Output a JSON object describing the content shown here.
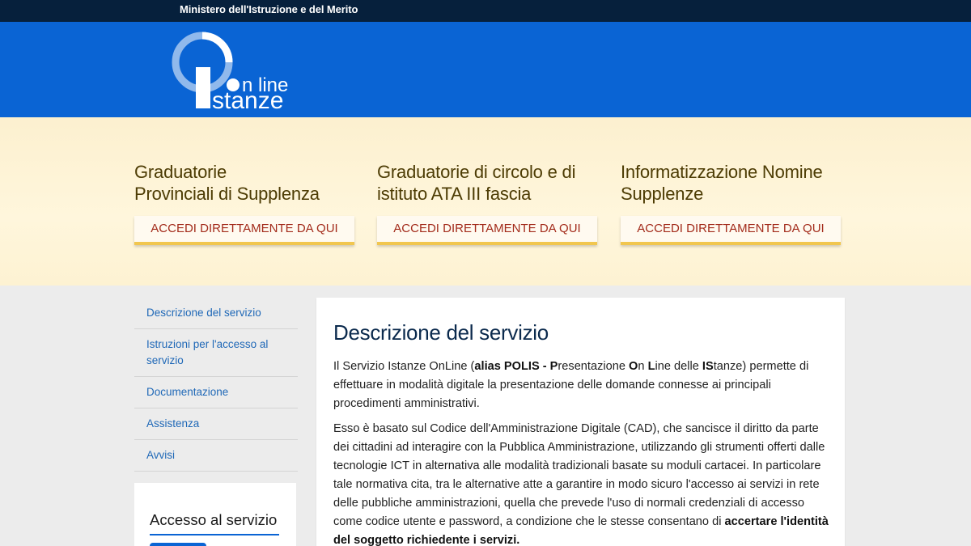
{
  "topbar": {
    "ministry": "Ministero dell'Istruzione e del Merito"
  },
  "logo": {
    "line1": "n line",
    "line2": "stanze"
  },
  "hero": {
    "cards": [
      {
        "title_line1": "Graduatorie",
        "title_line2": "Provinciali di Supplenza",
        "button": "ACCEDI DIRETTAMENTE DA QUI"
      },
      {
        "title_line1": "Graduatorie di circolo e di",
        "title_line2": "istituto ATA III fascia",
        "button": "ACCEDI DIRETTAMENTE DA QUI"
      },
      {
        "title_line1": "Informatizzazione Nomine",
        "title_line2": "Supplenze",
        "button": "ACCEDI DIRETTAMENTE DA QUI"
      }
    ]
  },
  "sidebar": {
    "items": [
      {
        "label": "Descrizione del servizio"
      },
      {
        "label": "Istruzioni per l'accesso al servizio"
      },
      {
        "label": "Documentazione"
      },
      {
        "label": "Assistenza"
      },
      {
        "label": "Avvisi"
      }
    ],
    "access_title": "Accesso al servizio"
  },
  "content": {
    "title": "Descrizione del servizio",
    "p1": {
      "a": "Il Servizio Istanze OnLine (",
      "b1": "alias POLIS - P",
      "c1": "resentazione ",
      "b2": "O",
      "c2": "n ",
      "b3": "L",
      "c3": "ine delle ",
      "b4": "IS",
      "d": "tanze) permette di effettuare in modalità digitale la presentazione delle domande connesse ai principali procedimenti amministrativi."
    },
    "p2": {
      "a": "Esso è basato sul Codice dell'Amministrazione Digitale (CAD), che sancisce il diritto da parte dei cittadini ad interagire con la Pubblica Amministrazione, utilizzando gli strumenti offerti dalle tecnologie ICT in alternativa alle modalità tradizionali basate su moduli cartacei. In particolare tale normativa cita, tra le alternative atte a garantire in modo sicuro l'accesso ai servizi in rete delle pubbliche amministrazioni, quella che prevede l'uso di normali credenziali di accesso come codice utente e password, a condizione che le stesse consentano di ",
      "b": "accertare l'identità del soggetto richiedente i servizi."
    }
  }
}
